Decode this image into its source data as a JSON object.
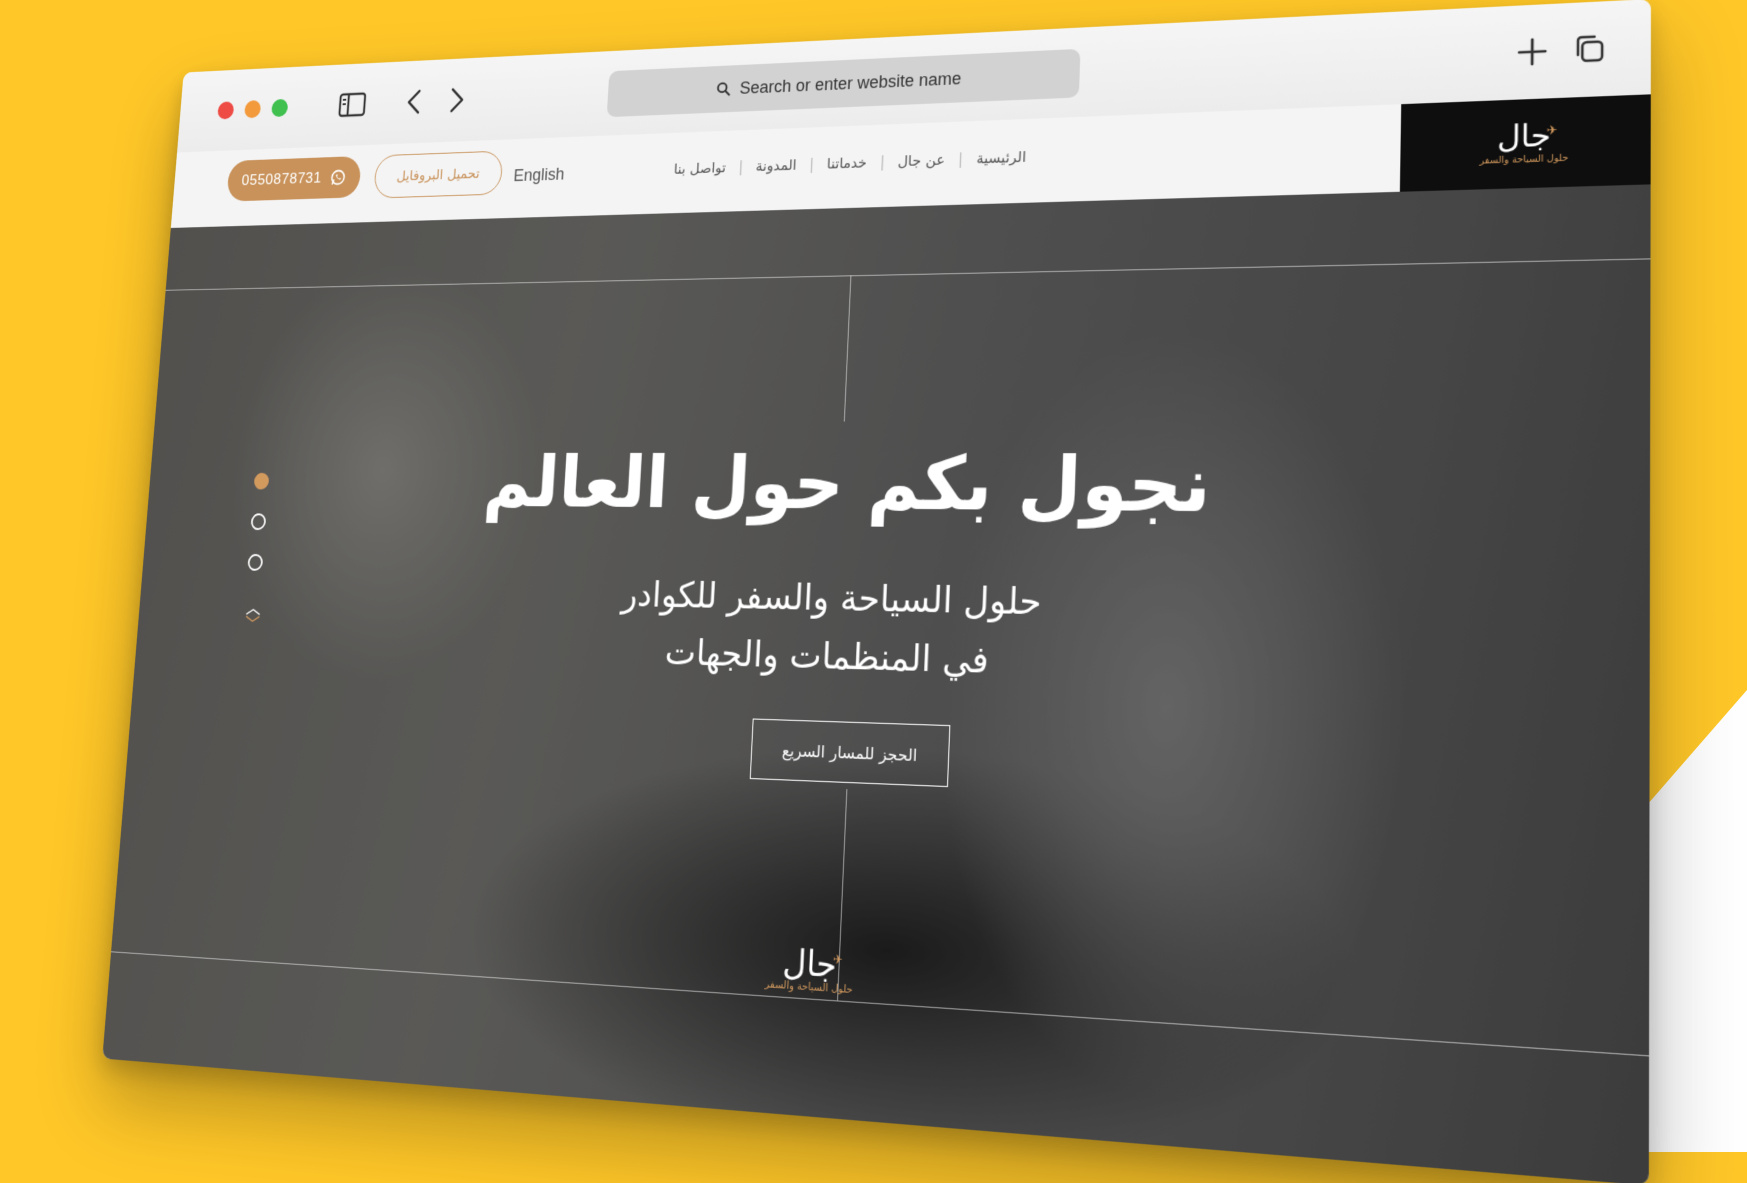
{
  "browser": {
    "search_placeholder": "Search or enter website name"
  },
  "site": {
    "logo_text": "جال",
    "logo_tagline": "حلول السياحة والسفر",
    "nav": [
      "الرئيسية",
      "عن جال",
      "خدماتنا",
      "المدونة",
      "تواصل بنا"
    ],
    "language": "English",
    "profile_button": "تحميل البروفايل",
    "phone": "0550878731"
  },
  "hero": {
    "title": "نجول بكم حول العالم",
    "subtitle_line1": "حلول السياحة والسفر للكوادر",
    "subtitle_line2": "في المنظمات والجهات",
    "cta": "الحجز للمسار السريع",
    "slides_count": 3,
    "active_slide": 1
  },
  "colors": {
    "background_yellow": "#FFC727",
    "accent_brown": "#C8925A",
    "logo_black": "#0E0E0E"
  }
}
